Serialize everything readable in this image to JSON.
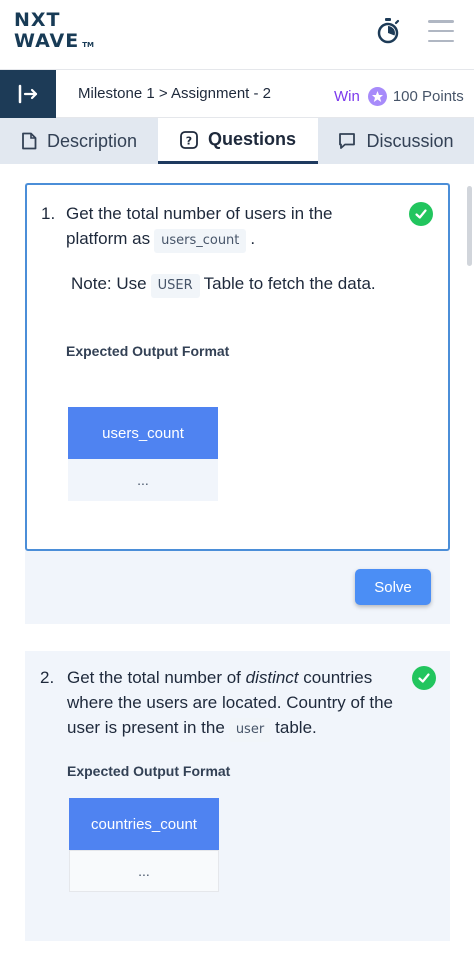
{
  "header": {
    "logo_line1": "NXT",
    "logo_line2": "WAVE",
    "logo_tm": "TM",
    "timer_icon": "stopwatch-icon",
    "menu_icon": "hamburger-menu-icon"
  },
  "crumb": {
    "breadcrumb": "Milestone 1 > Assignment - 2",
    "win_label": "Win",
    "points": "100 Points",
    "collapse_icon": "collapse-sidebar-icon"
  },
  "tabs": [
    {
      "label": "Description",
      "icon": "document-icon",
      "active": false
    },
    {
      "label": "Questions",
      "icon": "question-icon",
      "active": true
    },
    {
      "label": "Discussion",
      "icon": "chat-icon",
      "active": false
    }
  ],
  "questions": [
    {
      "number": "1.",
      "text_a": "Get the total number of users in the platform as",
      "code_a": "users_count",
      "text_b": ".",
      "note_a": "Note: Use",
      "note_code": "USER",
      "note_b": "Table to fetch the data.",
      "expected_label": "Expected Output Format",
      "column": "users_count",
      "cell": "...",
      "solve_label": "Solve",
      "status": "completed"
    },
    {
      "number": "2.",
      "text_a": "Get the total number of",
      "text_em": "distinct",
      "text_b": "countries where the users are located. Country of the user is present in the",
      "code_a": "user",
      "text_c": "table.",
      "expected_label": "Expected Output Format",
      "column": "countries_count",
      "cell": "...",
      "status": "completed"
    }
  ],
  "colors": {
    "brand_dark": "#1d3b57",
    "accent_blue": "#4f83f1",
    "success_green": "#22c55e",
    "points_purple": "#7c3aed"
  }
}
